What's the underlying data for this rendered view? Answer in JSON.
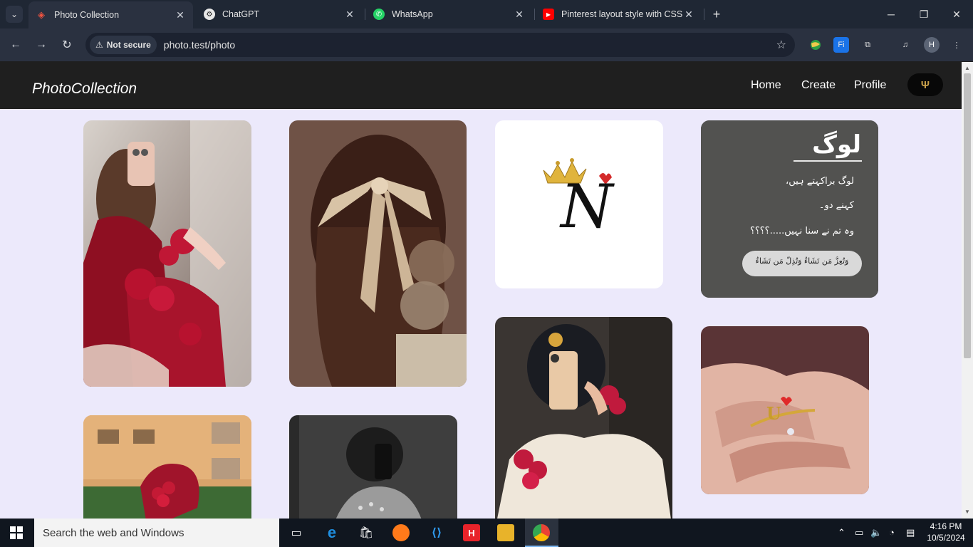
{
  "browser": {
    "tabs": [
      {
        "label": "Photo Collection",
        "active": true
      },
      {
        "label": "ChatGPT",
        "active": false
      },
      {
        "label": "WhatsApp",
        "active": false
      },
      {
        "label": "Pinterest layout style with CSS |",
        "active": false
      }
    ],
    "security_label": "Not secure",
    "url": "photo.test/photo",
    "profile_initial": "H"
  },
  "app": {
    "brand": "PhotoCollection",
    "nav": {
      "home": "Home",
      "create": "Create",
      "profile": "Profile"
    }
  },
  "photos": {
    "quote_title": "لوگ",
    "quote_lines": [
      "لوگ براکہتے ہیں،",
      "کہنے دو۔",
      "وہ تم نے سنا نہیں.....؟؟؟؟"
    ],
    "quote_verse": "وَتُعِزُّ مَن تَشَاءُ وَتُذِلُّ مَن تَشَاءُ",
    "monogram_letter": "N",
    "ring_letter": "U"
  },
  "taskbar": {
    "search_placeholder": "Search the web and Windows",
    "time": "4:16 PM",
    "date": "10/5/2024"
  },
  "colors": {
    "page_bg": "#ece9fb",
    "navbar_bg": "#1f1f1f",
    "accent_red": "#b5142c"
  }
}
